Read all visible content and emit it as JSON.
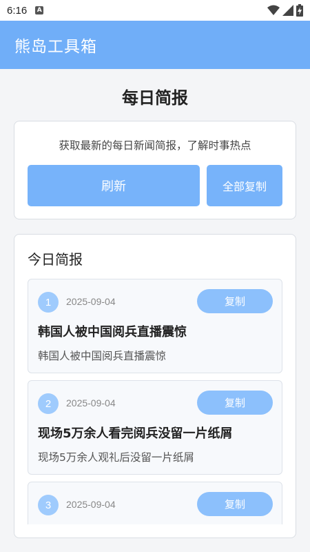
{
  "status_bar": {
    "time": "6:16",
    "notification_icon": "A",
    "icons": [
      "wifi-icon",
      "signal-icon",
      "battery-charging-icon"
    ]
  },
  "app_bar": {
    "title": "熊岛工具箱"
  },
  "page": {
    "title": "每日简报"
  },
  "intro_card": {
    "description": "获取最新的每日新闻简报，了解时事热点",
    "refresh_label": "刷新",
    "copy_all_label": "全部复制"
  },
  "today": {
    "title": "今日简报",
    "items": [
      {
        "index": "1",
        "date": "2025-09-04",
        "copy_label": "复制",
        "title": "韩国人被中国阅兵直播震惊",
        "summary": "韩国人被中国阅兵直播震惊"
      },
      {
        "index": "2",
        "date": "2025-09-04",
        "copy_label": "复制",
        "title": "现场5万余人看完阅兵没留一片纸屑",
        "summary": "现场5万余人观礼后没留一片纸屑"
      },
      {
        "index": "3",
        "date": "2025-09-04",
        "copy_label": "复制",
        "title": "",
        "summary": ""
      }
    ]
  },
  "colors": {
    "primary": "#70aef8",
    "button": "#77b3fa",
    "badge": "#9fcbfd",
    "copy_button": "#8cc0fc",
    "background": "#f4f5f7"
  }
}
